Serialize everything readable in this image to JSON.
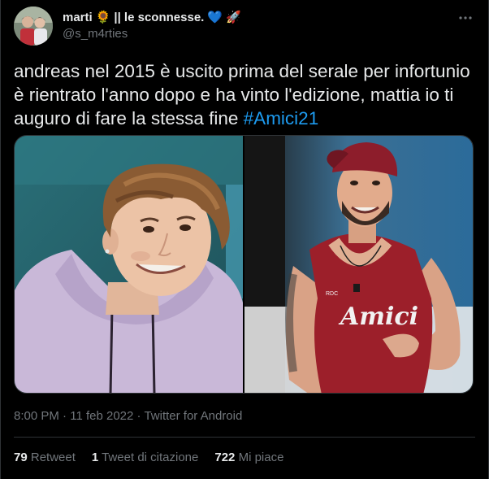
{
  "user": {
    "display_name": "marti",
    "emoji_sunflower": "🌻",
    "name_suffix": "|| le sconnesse.",
    "emoji_heart": "💙",
    "emoji_rocket": "🚀",
    "handle": "@s_m4rties"
  },
  "tweet": {
    "text_before_hashtag": "andreas nel 2015 è uscito prima del serale per infortunio è rientrato l'anno dopo e ha vinto l'edizione, mattia io ti auguro di fare la stessa fine ",
    "hashtag": "#Amici21"
  },
  "media": {
    "right_shirt_text": "Amici",
    "right_shirt_small": "RDC"
  },
  "meta": {
    "time": "8:00 PM",
    "separator": "·",
    "date": "11 feb 2022",
    "source": "Twitter for Android"
  },
  "stats": {
    "retweets_count": "79",
    "retweets_label": "Retweet",
    "quotes_count": "1",
    "quotes_label": "Tweet di citazione",
    "likes_count": "722",
    "likes_label": "Mi piace"
  },
  "icons": {
    "more": "more-dots-icon"
  },
  "colors": {
    "background": "#000000",
    "text": "#e7e9ea",
    "secondary": "#71767b",
    "accent": "#1d9bf0",
    "border": "#2f3336"
  }
}
